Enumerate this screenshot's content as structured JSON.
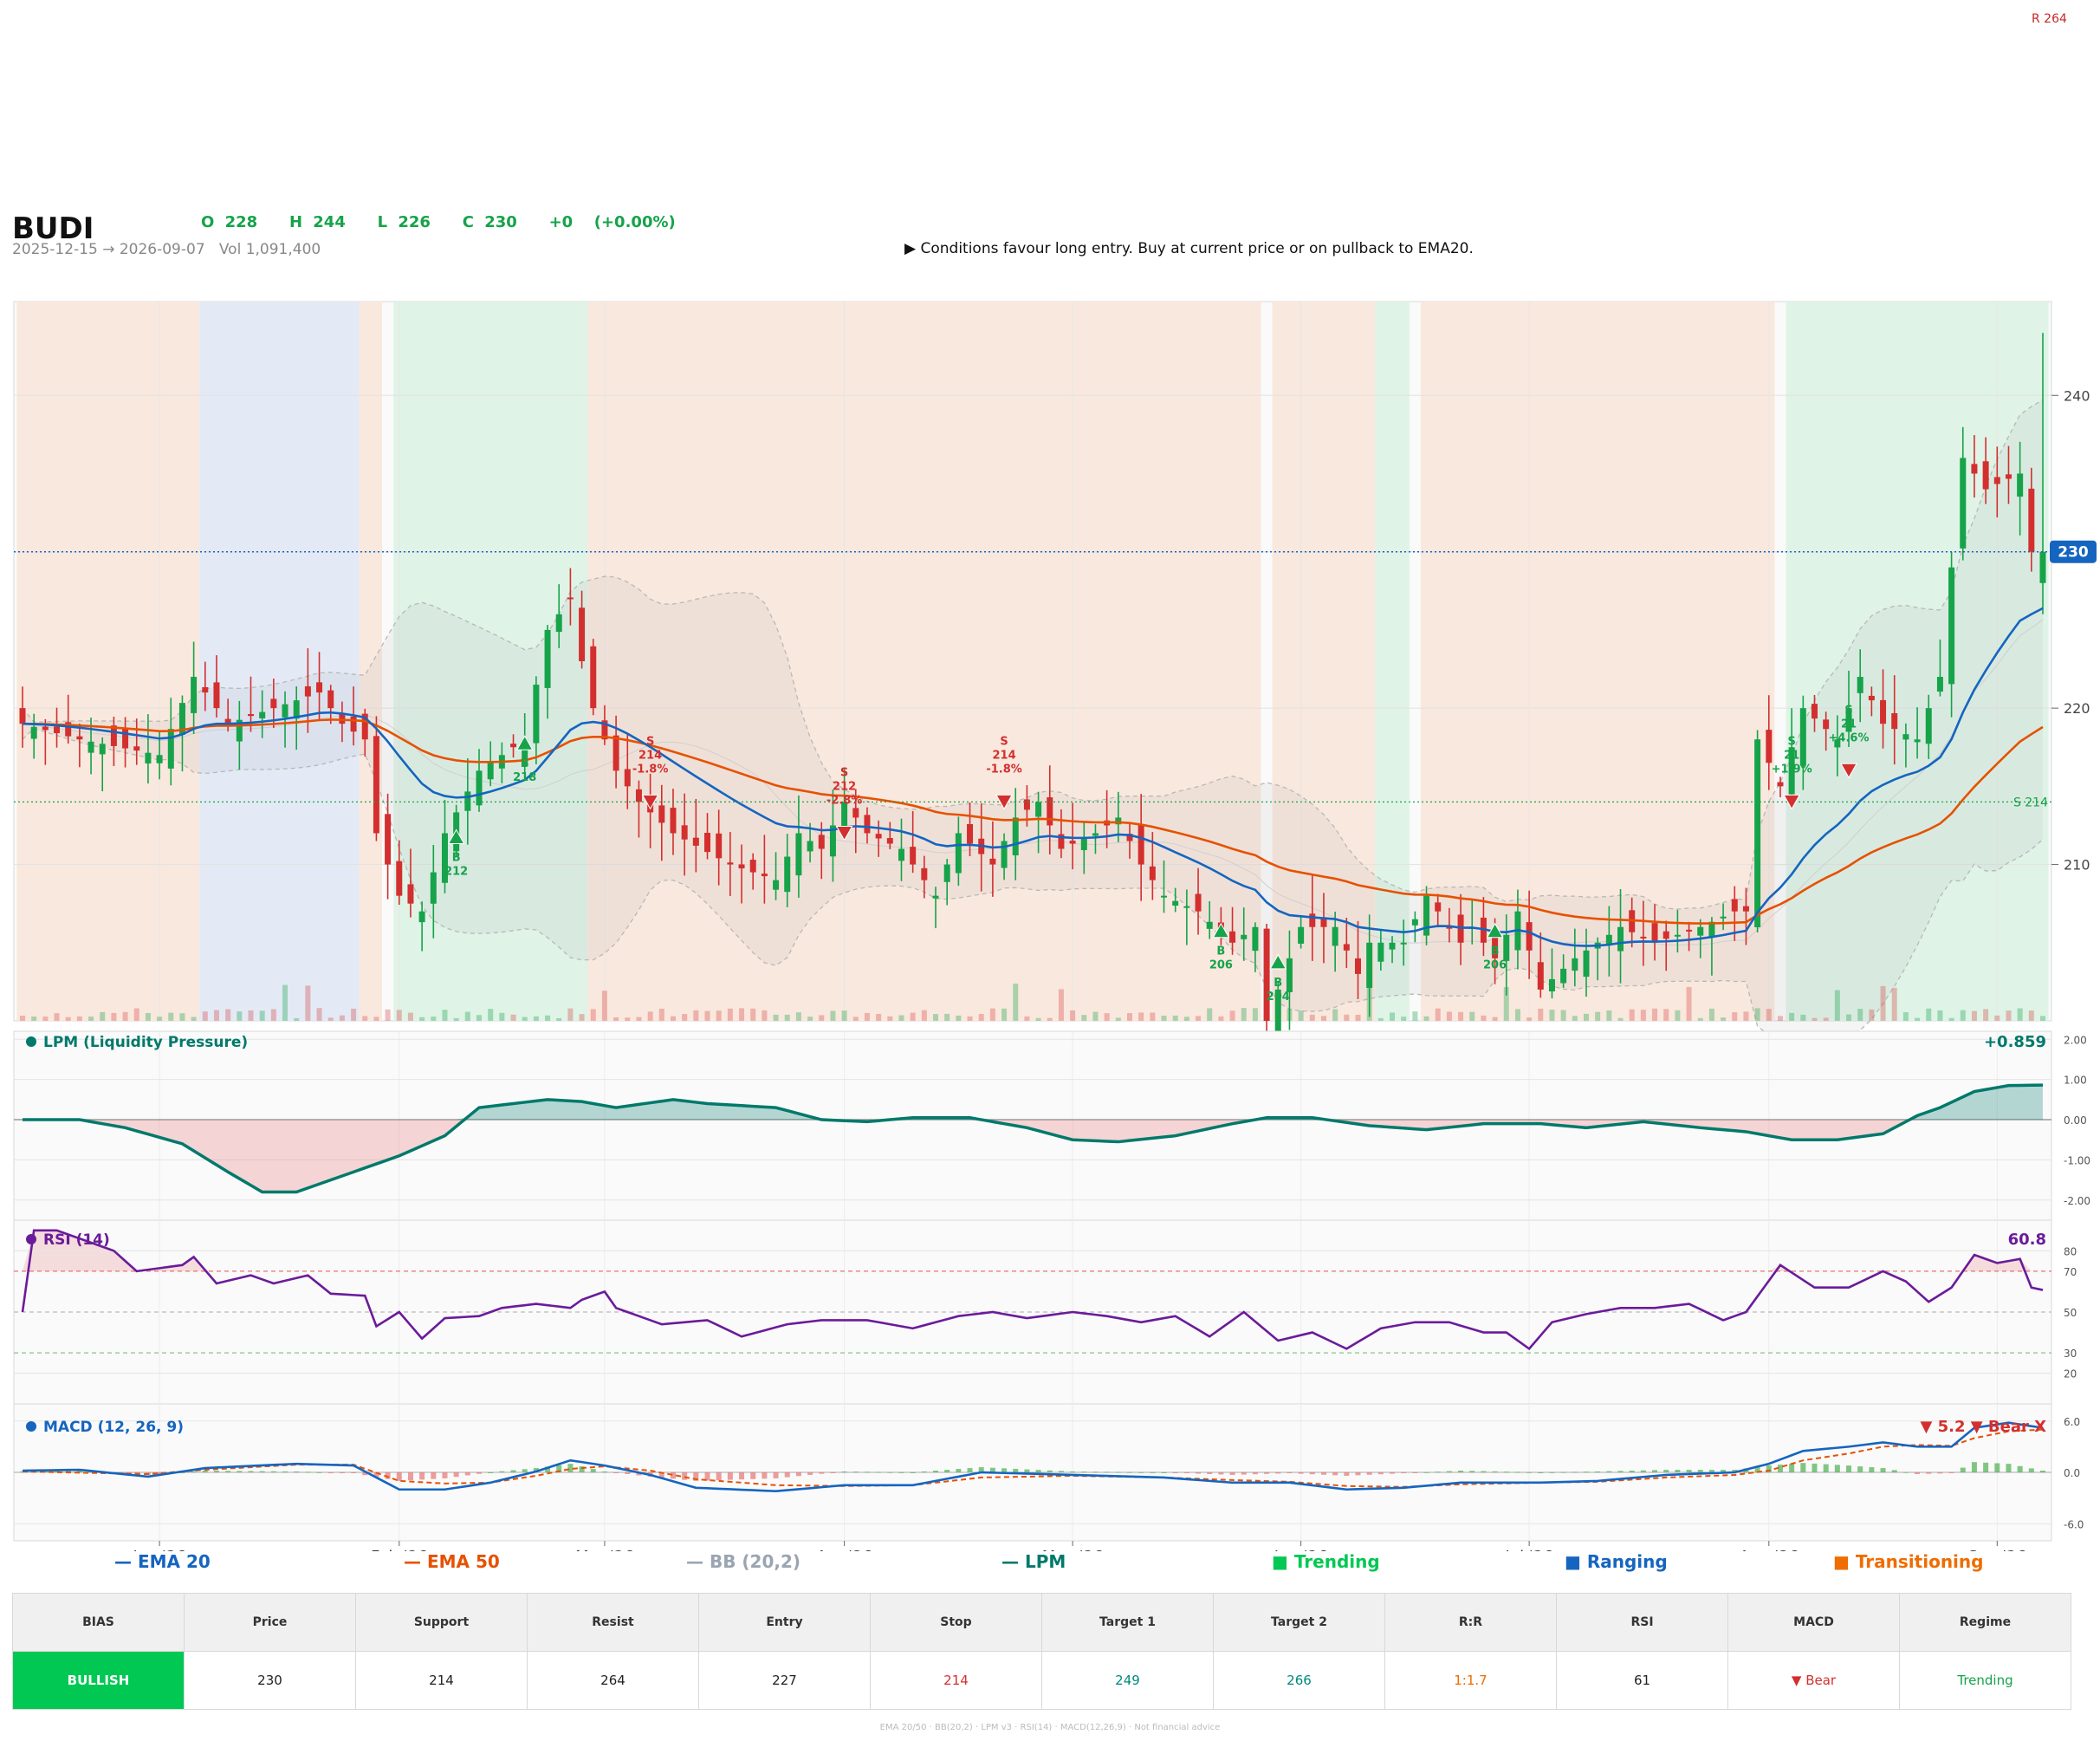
{
  "header": {
    "ticker": "BUDI",
    "ohlc": "O 228   H 244   L 226   C 230   +0  (+0.00%)",
    "date_range": "2025-12-15 → 2026-09-07   Vol 1,091,400",
    "advice": "▶  Conditions favour long entry. Buy at current price or on pullback to EMA20.",
    "resistance_label": "R 264"
  },
  "colors": {
    "up": "#16a34a",
    "down": "#d32f2f",
    "ema20": "#1565c0",
    "ema50": "#e65100",
    "bb": "#9aa5b1",
    "lpm": "#00796b",
    "rsi": "#6a1b9a",
    "regime_transitioning": "#f9e8dd",
    "regime_ranging": "#e3eaf5",
    "regime_trending": "#dff3e6"
  },
  "chart_data": {
    "type": "candlestick",
    "price_axis": {
      "min": 200,
      "max": 246,
      "ticks": [
        210,
        220,
        230,
        240
      ]
    },
    "x_axis": {
      "labels": [
        "Jan '26",
        "Feb '26",
        "Mar '26",
        "Apr '26",
        "May '26",
        "Jun '26",
        "Jul '26",
        "Aug '26",
        "Sep '26"
      ],
      "label_positions": [
        12,
        33,
        51,
        72,
        92,
        112,
        132,
        153,
        173
      ],
      "n": 178
    },
    "close_anchors": [
      [
        0,
        219
      ],
      [
        5,
        218
      ],
      [
        12,
        217
      ],
      [
        15,
        222
      ],
      [
        18,
        219
      ],
      [
        22,
        220
      ],
      [
        26,
        221
      ],
      [
        28,
        219
      ],
      [
        30,
        218
      ],
      [
        31,
        212
      ],
      [
        33,
        208
      ],
      [
        35,
        207
      ],
      [
        37,
        212
      ],
      [
        40,
        216
      ],
      [
        42,
        217
      ],
      [
        44,
        218
      ],
      [
        46,
        225
      ],
      [
        48,
        227
      ],
      [
        49,
        223
      ],
      [
        50,
        220
      ],
      [
        52,
        216
      ],
      [
        54,
        214
      ],
      [
        57,
        212
      ],
      [
        62,
        210
      ],
      [
        66,
        209
      ],
      [
        68,
        212
      ],
      [
        70,
        211
      ],
      [
        72,
        214
      ],
      [
        74,
        212
      ],
      [
        77,
        211
      ],
      [
        78,
        210
      ],
      [
        80,
        208
      ],
      [
        82,
        212
      ],
      [
        85,
        210
      ],
      [
        87,
        213
      ],
      [
        89,
        214
      ],
      [
        91,
        211
      ],
      [
        94,
        212
      ],
      [
        96,
        213
      ],
      [
        98,
        210
      ],
      [
        100,
        208
      ],
      [
        103,
        207
      ],
      [
        106,
        205
      ],
      [
        108,
        206
      ],
      [
        109,
        200
      ],
      [
        112,
        206
      ],
      [
        115,
        206
      ],
      [
        117,
        203
      ],
      [
        118,
        205
      ],
      [
        121,
        205
      ],
      [
        123,
        208
      ],
      [
        126,
        205
      ],
      [
        127,
        206
      ],
      [
        129,
        204
      ],
      [
        131,
        207
      ],
      [
        133,
        202
      ],
      [
        136,
        204
      ],
      [
        138,
        205
      ],
      [
        140,
        206
      ],
      [
        143,
        205
      ],
      [
        147,
        206
      ],
      [
        150,
        207
      ],
      [
        151,
        207
      ],
      [
        152,
        218
      ],
      [
        154,
        215
      ],
      [
        156,
        220
      ],
      [
        159,
        218
      ],
      [
        161,
        222
      ],
      [
        163,
        219
      ],
      [
        166,
        218
      ],
      [
        168,
        222
      ],
      [
        170,
        236
      ],
      [
        172,
        234
      ],
      [
        175,
        235
      ],
      [
        176,
        230
      ],
      [
        177,
        231
      ]
    ],
    "ohlc_last": {
      "open": 228,
      "high": 244,
      "low": 226,
      "close": 230
    },
    "last_price": 230,
    "support": 214,
    "resistance": 264,
    "support_label": "S 214",
    "regimes": [
      [
        0,
        15,
        "transitioning"
      ],
      [
        16,
        29,
        "ranging"
      ],
      [
        30,
        31,
        "transitioning"
      ],
      [
        33,
        49,
        "trending"
      ],
      [
        50,
        108,
        "transitioning"
      ],
      [
        110,
        118,
        "transitioning"
      ],
      [
        119,
        121,
        "trending"
      ],
      [
        123,
        153,
        "transitioning"
      ],
      [
        155,
        177,
        "trending"
      ]
    ],
    "signals": [
      {
        "i": 38,
        "type": "B",
        "price": 212,
        "label": "212",
        "pct": ""
      },
      {
        "i": 44,
        "type": "B",
        "price": 218,
        "label": "218",
        "pct": ""
      },
      {
        "i": 55,
        "type": "S",
        "price": 214,
        "label": "214",
        "pct": "-1.8%"
      },
      {
        "i": 72,
        "type": "S",
        "price": 212,
        "label": "212",
        "pct": "-2.8%"
      },
      {
        "i": 86,
        "type": "S",
        "price": 214,
        "label": "214",
        "pct": "-1.8%"
      },
      {
        "i": 105,
        "type": "B",
        "price": 206,
        "label": "206",
        "pct": ""
      },
      {
        "i": 110,
        "type": "B",
        "price": 204,
        "label": "204",
        "pct": ""
      },
      {
        "i": 129,
        "type": "B",
        "price": 206,
        "label": "206",
        "pct": ""
      },
      {
        "i": 155,
        "type": "S",
        "price": 214,
        "label": "21",
        "pct": "+1.9%"
      },
      {
        "i": 160,
        "type": "S",
        "price": 216,
        "label": "21",
        "pct": "+4.6%"
      }
    ],
    "lpm": {
      "title": "LPM (Liquidity Pressure)",
      "value_label": "+0.859",
      "ticks": [
        2,
        1,
        0,
        -1,
        -2
      ],
      "tick_labels": [
        "2.00",
        "1.00",
        "0.00",
        "-1.00",
        "-2.00"
      ],
      "anchors": [
        [
          0,
          0
        ],
        [
          5,
          0
        ],
        [
          9,
          -0.2
        ],
        [
          14,
          -0.6
        ],
        [
          18,
          -1.3
        ],
        [
          21,
          -1.8
        ],
        [
          24,
          -1.8
        ],
        [
          27,
          -1.5
        ],
        [
          30,
          -1.2
        ],
        [
          33,
          -0.9
        ],
        [
          37,
          -0.4
        ],
        [
          40,
          0.3
        ],
        [
          43,
          0.4
        ],
        [
          46,
          0.5
        ],
        [
          49,
          0.45
        ],
        [
          52,
          0.3
        ],
        [
          57,
          0.5
        ],
        [
          60,
          0.4
        ],
        [
          66,
          0.3
        ],
        [
          70,
          0
        ],
        [
          74,
          -0.05
        ],
        [
          78,
          0.05
        ],
        [
          83,
          0.05
        ],
        [
          88,
          -0.2
        ],
        [
          92,
          -0.5
        ],
        [
          96,
          -0.55
        ],
        [
          101,
          -0.4
        ],
        [
          106,
          -0.1
        ],
        [
          109,
          0.05
        ],
        [
          113,
          0.05
        ],
        [
          118,
          -0.15
        ],
        [
          123,
          -0.25
        ],
        [
          128,
          -0.1
        ],
        [
          133,
          -0.1
        ],
        [
          137,
          -0.2
        ],
        [
          142,
          -0.05
        ],
        [
          147,
          -0.2
        ],
        [
          151,
          -0.3
        ],
        [
          155,
          -0.5
        ],
        [
          159,
          -0.5
        ],
        [
          163,
          -0.35
        ],
        [
          166,
          0.1
        ],
        [
          168,
          0.3
        ],
        [
          171,
          0.7
        ],
        [
          174,
          0.85
        ],
        [
          177,
          0.86
        ]
      ]
    },
    "rsi": {
      "title": "RSI (14)",
      "value_label": "60.8",
      "ticks": [
        80,
        70,
        50,
        30,
        20
      ],
      "anchors": [
        [
          0,
          50
        ],
        [
          1,
          90
        ],
        [
          3,
          90
        ],
        [
          8,
          80
        ],
        [
          10,
          70
        ],
        [
          14,
          73
        ],
        [
          15,
          77
        ],
        [
          17,
          64
        ],
        [
          20,
          68
        ],
        [
          22,
          64
        ],
        [
          25,
          68
        ],
        [
          27,
          59
        ],
        [
          30,
          58
        ],
        [
          31,
          43
        ],
        [
          33,
          50
        ],
        [
          35,
          37
        ],
        [
          37,
          47
        ],
        [
          40,
          48
        ],
        [
          42,
          52
        ],
        [
          45,
          54
        ],
        [
          48,
          52
        ],
        [
          49,
          56
        ],
        [
          51,
          60
        ],
        [
          52,
          52
        ],
        [
          54,
          48
        ],
        [
          56,
          44
        ],
        [
          60,
          46
        ],
        [
          63,
          38
        ],
        [
          67,
          44
        ],
        [
          70,
          46
        ],
        [
          74,
          46
        ],
        [
          78,
          42
        ],
        [
          82,
          48
        ],
        [
          85,
          50
        ],
        [
          88,
          47
        ],
        [
          92,
          50
        ],
        [
          95,
          48
        ],
        [
          98,
          45
        ],
        [
          101,
          48
        ],
        [
          104,
          38
        ],
        [
          107,
          50
        ],
        [
          110,
          36
        ],
        [
          113,
          40
        ],
        [
          116,
          32
        ],
        [
          119,
          42
        ],
        [
          122,
          45
        ],
        [
          125,
          45
        ],
        [
          128,
          40
        ],
        [
          130,
          40
        ],
        [
          132,
          32
        ],
        [
          134,
          45
        ],
        [
          137,
          49
        ],
        [
          140,
          52
        ],
        [
          143,
          52
        ],
        [
          146,
          54
        ],
        [
          149,
          46
        ],
        [
          151,
          50
        ],
        [
          154,
          73
        ],
        [
          157,
          62
        ],
        [
          160,
          62
        ],
        [
          163,
          70
        ],
        [
          165,
          65
        ],
        [
          167,
          55
        ],
        [
          169,
          62
        ],
        [
          171,
          78
        ],
        [
          173,
          74
        ],
        [
          175,
          76
        ],
        [
          176,
          62
        ],
        [
          177,
          60.8
        ]
      ]
    },
    "macd": {
      "title": "MACD (12, 26, 9)",
      "value_label": "▼ 5.2 ▼ Bear X",
      "ticks": [
        6,
        0,
        -6
      ],
      "tick_labels": [
        "6.0",
        "0.0",
        "-6.0"
      ],
      "range": [
        -8,
        8
      ],
      "line_anchors": [
        [
          0,
          0.2
        ],
        [
          5,
          0.3
        ],
        [
          11,
          -0.5
        ],
        [
          16,
          0.5
        ],
        [
          24,
          1.0
        ],
        [
          29,
          0.8
        ],
        [
          33,
          -2.0
        ],
        [
          37,
          -2.0
        ],
        [
          41,
          -1.2
        ],
        [
          45,
          0.1
        ],
        [
          48,
          1.4
        ],
        [
          51,
          0.8
        ],
        [
          55,
          -0.3
        ],
        [
          59,
          -1.8
        ],
        [
          66,
          -2.2
        ],
        [
          72,
          -1.5
        ],
        [
          78,
          -1.5
        ],
        [
          84,
          0
        ],
        [
          92,
          -0.3
        ],
        [
          100,
          -0.6
        ],
        [
          106,
          -1.2
        ],
        [
          111,
          -1.2
        ],
        [
          116,
          -2.0
        ],
        [
          121,
          -1.8
        ],
        [
          126,
          -1.2
        ],
        [
          133,
          -1.2
        ],
        [
          138,
          -1.0
        ],
        [
          144,
          -0.3
        ],
        [
          150,
          0
        ],
        [
          153,
          1.0
        ],
        [
          156,
          2.5
        ],
        [
          160,
          3.0
        ],
        [
          163,
          3.5
        ],
        [
          166,
          3.0
        ],
        [
          169,
          3.0
        ],
        [
          171,
          5.2
        ],
        [
          174,
          5.8
        ],
        [
          177,
          5.2
        ]
      ],
      "signal_anchors": [
        [
          0,
          0.1
        ],
        [
          11,
          -0.2
        ],
        [
          16,
          0.3
        ],
        [
          24,
          0.9
        ],
        [
          29,
          0.9
        ],
        [
          33,
          -1.0
        ],
        [
          37,
          -1.3
        ],
        [
          41,
          -1.2
        ],
        [
          45,
          -0.4
        ],
        [
          48,
          0.4
        ],
        [
          51,
          0.7
        ],
        [
          55,
          0.2
        ],
        [
          59,
          -0.8
        ],
        [
          66,
          -1.5
        ],
        [
          72,
          -1.6
        ],
        [
          78,
          -1.5
        ],
        [
          84,
          -0.6
        ],
        [
          92,
          -0.4
        ],
        [
          100,
          -0.6
        ],
        [
          106,
          -0.9
        ],
        [
          111,
          -1.1
        ],
        [
          116,
          -1.6
        ],
        [
          121,
          -1.7
        ],
        [
          126,
          -1.4
        ],
        [
          133,
          -1.2
        ],
        [
          138,
          -1.1
        ],
        [
          144,
          -0.6
        ],
        [
          150,
          -0.3
        ],
        [
          153,
          0.2
        ],
        [
          156,
          1.4
        ],
        [
          160,
          2.2
        ],
        [
          163,
          3.0
        ],
        [
          166,
          3.2
        ],
        [
          169,
          3.1
        ],
        [
          171,
          4.0
        ],
        [
          174,
          4.8
        ],
        [
          177,
          5.0
        ]
      ]
    }
  },
  "legend": [
    {
      "label": "EMA 20",
      "color": "#1565c0",
      "kind": "line"
    },
    {
      "label": "EMA 50",
      "color": "#e65100",
      "kind": "line"
    },
    {
      "label": "BB (20,2)",
      "color": "#9aa5b1",
      "kind": "line"
    },
    {
      "label": "LPM",
      "color": "#00796b",
      "kind": "line"
    },
    {
      "label": "Trending",
      "color": "#00c853",
      "kind": "box"
    },
    {
      "label": "Ranging",
      "color": "#1565c0",
      "kind": "box"
    },
    {
      "label": "Transitioning",
      "color": "#ef6c00",
      "kind": "box"
    }
  ],
  "table": {
    "headers": [
      "BIAS",
      "Price",
      "Support",
      "Resist",
      "Entry",
      "Stop",
      "Target 1",
      "Target 2",
      "R:R",
      "RSI",
      "MACD",
      "Regime"
    ],
    "values": [
      "BULLISH",
      "230",
      "214",
      "264",
      "227",
      "214",
      "249",
      "266",
      "1:1.7",
      "61",
      "▼ Bear",
      "Trending"
    ],
    "value_colors": [
      "#ffffff",
      "#222222",
      "#222222",
      "#222222",
      "#222222",
      "#d32f2f",
      "#00897b",
      "#00897b",
      "#ef6c00",
      "#222222",
      "#d32f2f",
      "#16a34a"
    ]
  },
  "footer": "EMA 20/50  ·  BB(20,2)  ·  LPM v3  ·  RSI(14)  ·  MACD(12,26,9)  ·  Not financial advice"
}
